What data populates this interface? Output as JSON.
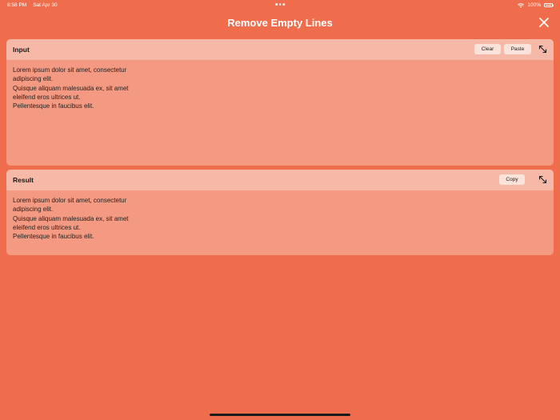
{
  "status_bar": {
    "time": "8:58 PM",
    "date": "Sat Apr 30",
    "battery": "100%"
  },
  "header": {
    "title": "Remove Empty Lines"
  },
  "input_panel": {
    "label": "Input",
    "clear_label": "Clear",
    "paste_label": "Paste",
    "lines": [
      "Lorem ipsum dolor sit amet, consectetur",
      "adipiscing elit.",
      "Quisque aliquam malesuada ex, sit amet",
      "eleifend eros ultrices ut.",
      "Pellentesque in faucibus elit."
    ]
  },
  "result_panel": {
    "label": "Result",
    "copy_label": "Copy",
    "lines": [
      "Lorem ipsum dolor sit amet, consectetur",
      "adipiscing elit.",
      "Quisque aliquam malesuada ex, sit amet",
      "eleifend eros ultrices ut.",
      "Pellentesque in faucibus elit."
    ]
  },
  "icons": {
    "close": "close-icon",
    "expand": "expand-icon",
    "wifi": "wifi-icon",
    "battery": "battery-icon"
  },
  "colors": {
    "background": "#ef6d4d",
    "card": "#f49a82",
    "card_header": "#f7b9a7",
    "button": "#fbe2da"
  }
}
